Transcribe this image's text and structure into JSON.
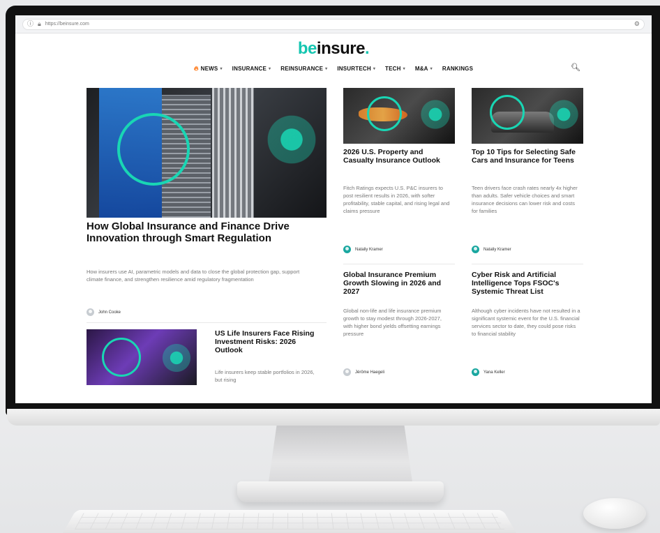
{
  "browser": {
    "url": "https://beinsure.com"
  },
  "site": {
    "logo_prefix": "be",
    "logo_rest": "insure",
    "logo_dot": ".",
    "brand_color": "#15c6b1"
  },
  "nav": {
    "items": [
      {
        "label": "NEWS",
        "has_dropdown": true,
        "icon": "fire-icon"
      },
      {
        "label": "INSURANCE",
        "has_dropdown": true
      },
      {
        "label": "REINSURANCE",
        "has_dropdown": true
      },
      {
        "label": "INSURTECH",
        "has_dropdown": true
      },
      {
        "label": "TECH",
        "has_dropdown": true
      },
      {
        "label": "M&A",
        "has_dropdown": true
      },
      {
        "label": "RANKINGS",
        "has_dropdown": false
      }
    ],
    "search_icon": "search-icon"
  },
  "featured": {
    "title": "How Global Insurance and Finance Drive Innovation through Smart Regulation",
    "description": "How insurers use AI, parametric models and data to close the global protection gap, support climate finance, and strengthen resilience amid regulatory fragmentation",
    "author": "John Cooke"
  },
  "secondary": {
    "title": "US Life Insurers Face Rising Investment Risks: 2026 Outlook",
    "description": "Life insurers keep stable portfolios in 2026, but rising"
  },
  "cards": [
    {
      "title": "2026 U.S. Property and Casualty Insurance Outlook",
      "description": "Fitch Ratings expects U.S. P&C insurers to post resilient results in 2026, with softer profitability, stable capital, and rising legal and claims pressure",
      "author": "Nataliy Kramer"
    },
    {
      "title": "Top 10 Tips for Selecting Safe Cars and Insurance for Teens",
      "description": "Teen drivers face crash rates nearly 4x higher than adults. Safer vehicle choices and smart insurance decisions can lower risk and costs for families",
      "author": "Nataliy Kramer"
    },
    {
      "title": "Global Insurance Premium Growth Slowing in 2026 and 2027",
      "description": "Global non-life and life insurance premium growth to stay modest through 2026-2027, with higher bond yields offsetting earnings pressure",
      "author": "Jérôme Haegeli"
    },
    {
      "title": "Cyber Risk and Artificial Intelligence Tops FSOC's Systemic Threat List",
      "description": "Although cyber incidents have not resulted in a significant systemic event for the U.S. financial services sector to date, they could pose risks to financial stability",
      "author": "Yana Keller"
    }
  ]
}
